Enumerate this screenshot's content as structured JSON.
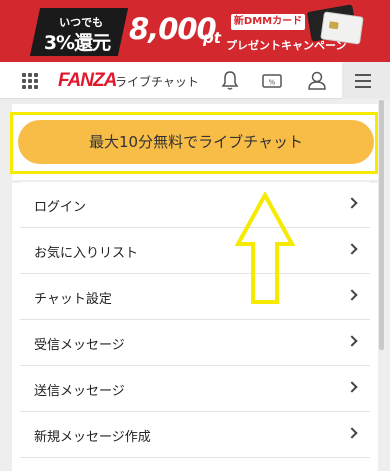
{
  "banner": {
    "badge_top": "いつでも",
    "badge_main": "3%還元",
    "amount": "8,000",
    "unit": "pt",
    "card_label": "新DMMカード",
    "subtitle": "プレゼントキャンペーン"
  },
  "header": {
    "logo": "FANZA",
    "logo_sub": "ライブチャット"
  },
  "cta": {
    "label": "最大10分無料でライブチャット"
  },
  "menu": {
    "items": [
      {
        "label": "ログイン"
      },
      {
        "label": "お気に入りリスト"
      },
      {
        "label": "チャット設定"
      },
      {
        "label": "受信メッセージ"
      },
      {
        "label": "送信メッセージ"
      },
      {
        "label": "新規メッセージ作成"
      }
    ]
  },
  "colors": {
    "banner": "#d3282e",
    "cta": "#f7bd47",
    "highlight": "#f5ea00",
    "logo": "#e0182c"
  }
}
